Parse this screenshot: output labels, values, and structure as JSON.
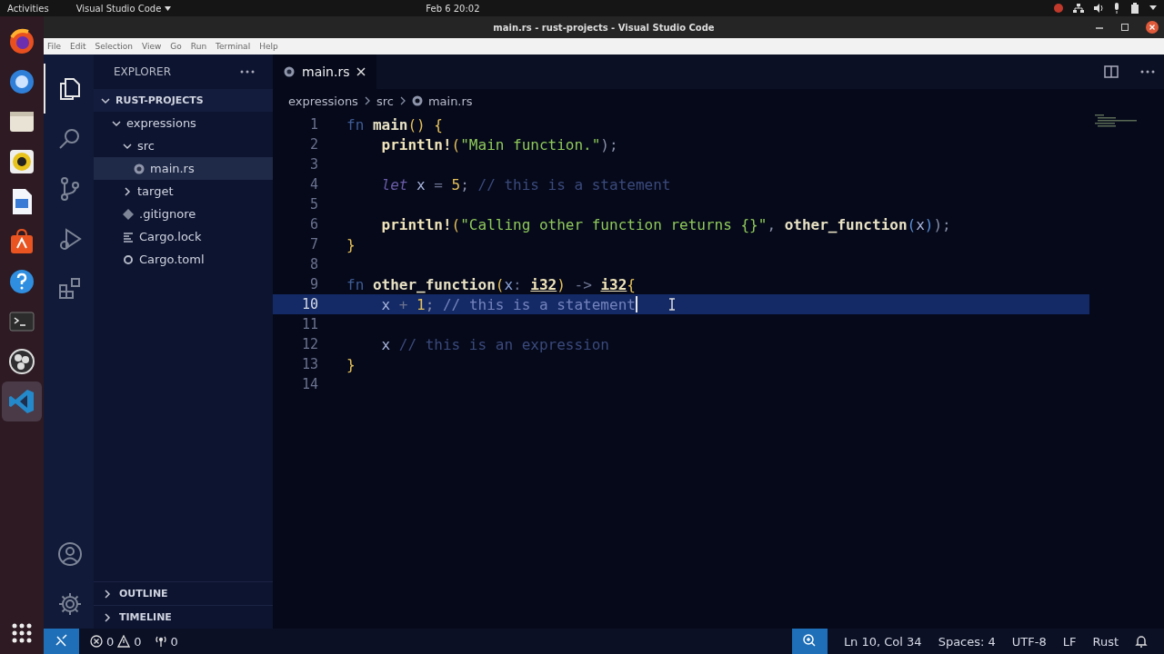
{
  "top_bar": {
    "activities": "Activities",
    "app_menu": "Visual Studio Code",
    "clock": "Feb 6  20:02"
  },
  "window": {
    "title": "main.rs - rust-projects - Visual Studio Code"
  },
  "menu": [
    "File",
    "Edit",
    "Selection",
    "View",
    "Go",
    "Run",
    "Terminal",
    "Help"
  ],
  "dock": [
    {
      "kind": "browser",
      "selected": false
    },
    {
      "kind": "mail",
      "selected": false
    },
    {
      "kind": "files",
      "selected": false
    },
    {
      "kind": "music",
      "selected": false
    },
    {
      "kind": "writer",
      "selected": false
    },
    {
      "kind": "store",
      "selected": false
    },
    {
      "kind": "help",
      "selected": false
    },
    {
      "kind": "terminal",
      "selected": false
    },
    {
      "kind": "recorder",
      "selected": false
    },
    {
      "kind": "editor",
      "selected": true
    }
  ],
  "activity_bar": [
    {
      "kind": "explorer",
      "selected": true
    },
    {
      "kind": "search",
      "selected": false
    },
    {
      "kind": "source-control",
      "selected": false
    },
    {
      "kind": "run",
      "selected": false
    },
    {
      "kind": "extensions",
      "selected": false
    }
  ],
  "sidebar": {
    "title": "EXPLORER",
    "tree": [
      {
        "label": "RUST-PROJECTS",
        "kind": "root",
        "expanded": true,
        "selected": false,
        "children": [
          {
            "label": "expressions",
            "kind": "folder",
            "expanded": true,
            "selected": false,
            "children": [
              {
                "label": "src",
                "kind": "folder",
                "expanded": true,
                "selected": false,
                "children": [
                  {
                    "label": "main.rs",
                    "kind": "rust",
                    "selected": true
                  }
                ]
              },
              {
                "label": "target",
                "kind": "folder",
                "expanded": false,
                "selected": false
              },
              {
                "label": ".gitignore",
                "kind": "git",
                "selected": false
              },
              {
                "label": "Cargo.lock",
                "kind": "lock",
                "selected": false
              },
              {
                "label": "Cargo.toml",
                "kind": "toml",
                "selected": false
              }
            ]
          }
        ]
      }
    ],
    "sections": [
      {
        "label": "OUTLINE",
        "expanded": false
      },
      {
        "label": "TIMELINE",
        "expanded": false
      }
    ]
  },
  "editor": {
    "tabs": [
      {
        "label": "main.rs",
        "selected": true
      }
    ],
    "breadcrumb": [
      "expressions",
      "src",
      "main.rs"
    ],
    "lines": [
      {
        "number": "1",
        "selected": false,
        "tokens": [
          {
            "t": "fn",
            "kind": "keyword"
          },
          {
            "t": " main",
            "kind": "function"
          },
          {
            "t": "()",
            "kind": "paren"
          },
          {
            "t": " {",
            "kind": "brace"
          }
        ]
      },
      {
        "number": "2",
        "selected": false,
        "tokens": [
          {
            "t": "    println!",
            "kind": "macro"
          },
          {
            "t": "(",
            "kind": "paren"
          },
          {
            "t": "\"Main function.\"",
            "kind": "string"
          },
          {
            "t": ");",
            "kind": "punct"
          }
        ]
      },
      {
        "number": "3",
        "selected": false
      },
      {
        "number": "4",
        "selected": false,
        "tokens": [
          {
            "t": "    let",
            "kind": "storage"
          },
          {
            "t": " x",
            "kind": "variable"
          },
          {
            "t": " =",
            "kind": "operator"
          },
          {
            "t": " 5",
            "kind": "number"
          },
          {
            "t": ";",
            "kind": "punct"
          },
          {
            "t": " // this is a statement",
            "kind": "comment"
          }
        ]
      },
      {
        "number": "5",
        "selected": false
      },
      {
        "number": "6",
        "selected": false,
        "tokens": [
          {
            "t": "    println!",
            "kind": "macro"
          },
          {
            "t": "(",
            "kind": "paren"
          },
          {
            "t": "\"Calling other function returns {}\"",
            "kind": "string"
          },
          {
            "t": ",",
            "kind": "punct"
          },
          {
            "t": " other_function",
            "kind": "function"
          },
          {
            "t": "(",
            "kind": "paren2"
          },
          {
            "t": "x",
            "kind": "variable"
          },
          {
            "t": ")",
            "kind": "paren2"
          },
          {
            "t": ");",
            "kind": "punct"
          }
        ]
      },
      {
        "number": "7",
        "selected": false,
        "tokens": [
          {
            "t": "}",
            "kind": "brace"
          }
        ]
      },
      {
        "number": "8",
        "selected": false
      },
      {
        "number": "9",
        "selected": false,
        "tokens": [
          {
            "t": "fn",
            "kind": "keyword"
          },
          {
            "t": " other_function",
            "kind": "function"
          },
          {
            "t": "(",
            "kind": "paren"
          },
          {
            "t": "x",
            "kind": "parameter"
          },
          {
            "t": ": ",
            "kind": "operator"
          },
          {
            "t": "i32",
            "kind": "type"
          },
          {
            "t": ")",
            "kind": "paren"
          },
          {
            "t": " -> ",
            "kind": "operator"
          },
          {
            "t": "i32",
            "kind": "type"
          },
          {
            "t": "{",
            "kind": "brace"
          }
        ]
      },
      {
        "number": "10",
        "selected": true,
        "tokens": [
          {
            "t": "    x",
            "kind": "variable"
          },
          {
            "t": " +",
            "kind": "operator"
          },
          {
            "t": " 1",
            "kind": "number"
          },
          {
            "t": ";",
            "kind": "punct"
          },
          {
            "t": " // this is a statement",
            "kind": "comment"
          }
        ]
      },
      {
        "number": "11",
        "selected": false
      },
      {
        "number": "12",
        "selected": false,
        "tokens": [
          {
            "t": "    x",
            "kind": "variable"
          },
          {
            "t": " // this is an expression",
            "kind": "comment"
          }
        ]
      },
      {
        "number": "13",
        "selected": false,
        "tokens": [
          {
            "t": "}",
            "kind": "brace"
          }
        ]
      },
      {
        "number": "14",
        "selected": false
      }
    ]
  },
  "status_bar": {
    "errors": "0",
    "warnings": "0",
    "ports": "0",
    "position": "Ln 10, Col 34",
    "indent": "Spaces: 4",
    "encoding": "UTF-8",
    "eol": "LF",
    "language": "Rust"
  }
}
